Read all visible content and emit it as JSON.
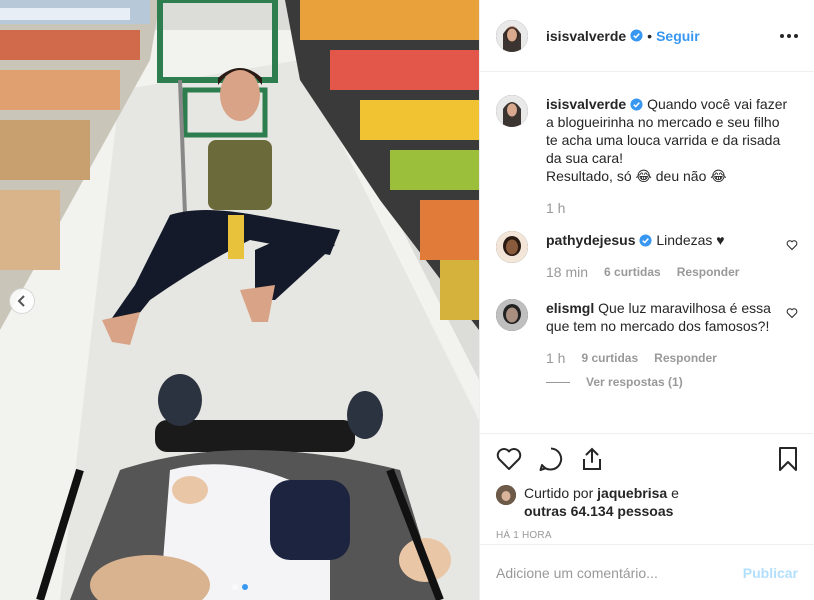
{
  "post": {
    "author": "isisvalverde",
    "separator": "•",
    "follow_label": "Seguir",
    "caption_lines": [
      "Quando você vai fazer",
      "a blogueirinha no mercado e seu filho",
      "te acha uma louca varrida e da risada",
      "da sua cara!",
      "Resultado, só 😂 deu não 😂"
    ],
    "caption_time": "1 h"
  },
  "comments": [
    {
      "user": "pathydejesus",
      "verified": true,
      "text": "Lindezas ♥",
      "time": "18 min",
      "likes": "6 curtidas",
      "reply_label": "Responder"
    },
    {
      "user": "elismgl",
      "verified": false,
      "text": "Que luz maravilhosa é essa que tem no mercado dos famosos?!",
      "time": "1 h",
      "likes": "9 curtidas",
      "reply_label": "Responder",
      "view_replies": "Ver respostas (1)"
    }
  ],
  "likes_info": {
    "prefix": "Curtido por",
    "liker": "jaquebrisa",
    "joiner": "e",
    "others": "outras 64.134 pessoas"
  },
  "timestamp": "HÁ 1 HORA",
  "add_comment": {
    "placeholder": "Adicione um comentário...",
    "publish_label": "Publicar"
  },
  "colors": {
    "accent": "#3897f0",
    "verified": "#3897f0",
    "publish_disabled": "#b2dffc",
    "muted": "#999999"
  },
  "icons": [
    "verified-badge-icon",
    "more-options-icon",
    "heart-icon",
    "comment-icon",
    "share-icon",
    "bookmark-icon",
    "chevron-left-icon"
  ]
}
